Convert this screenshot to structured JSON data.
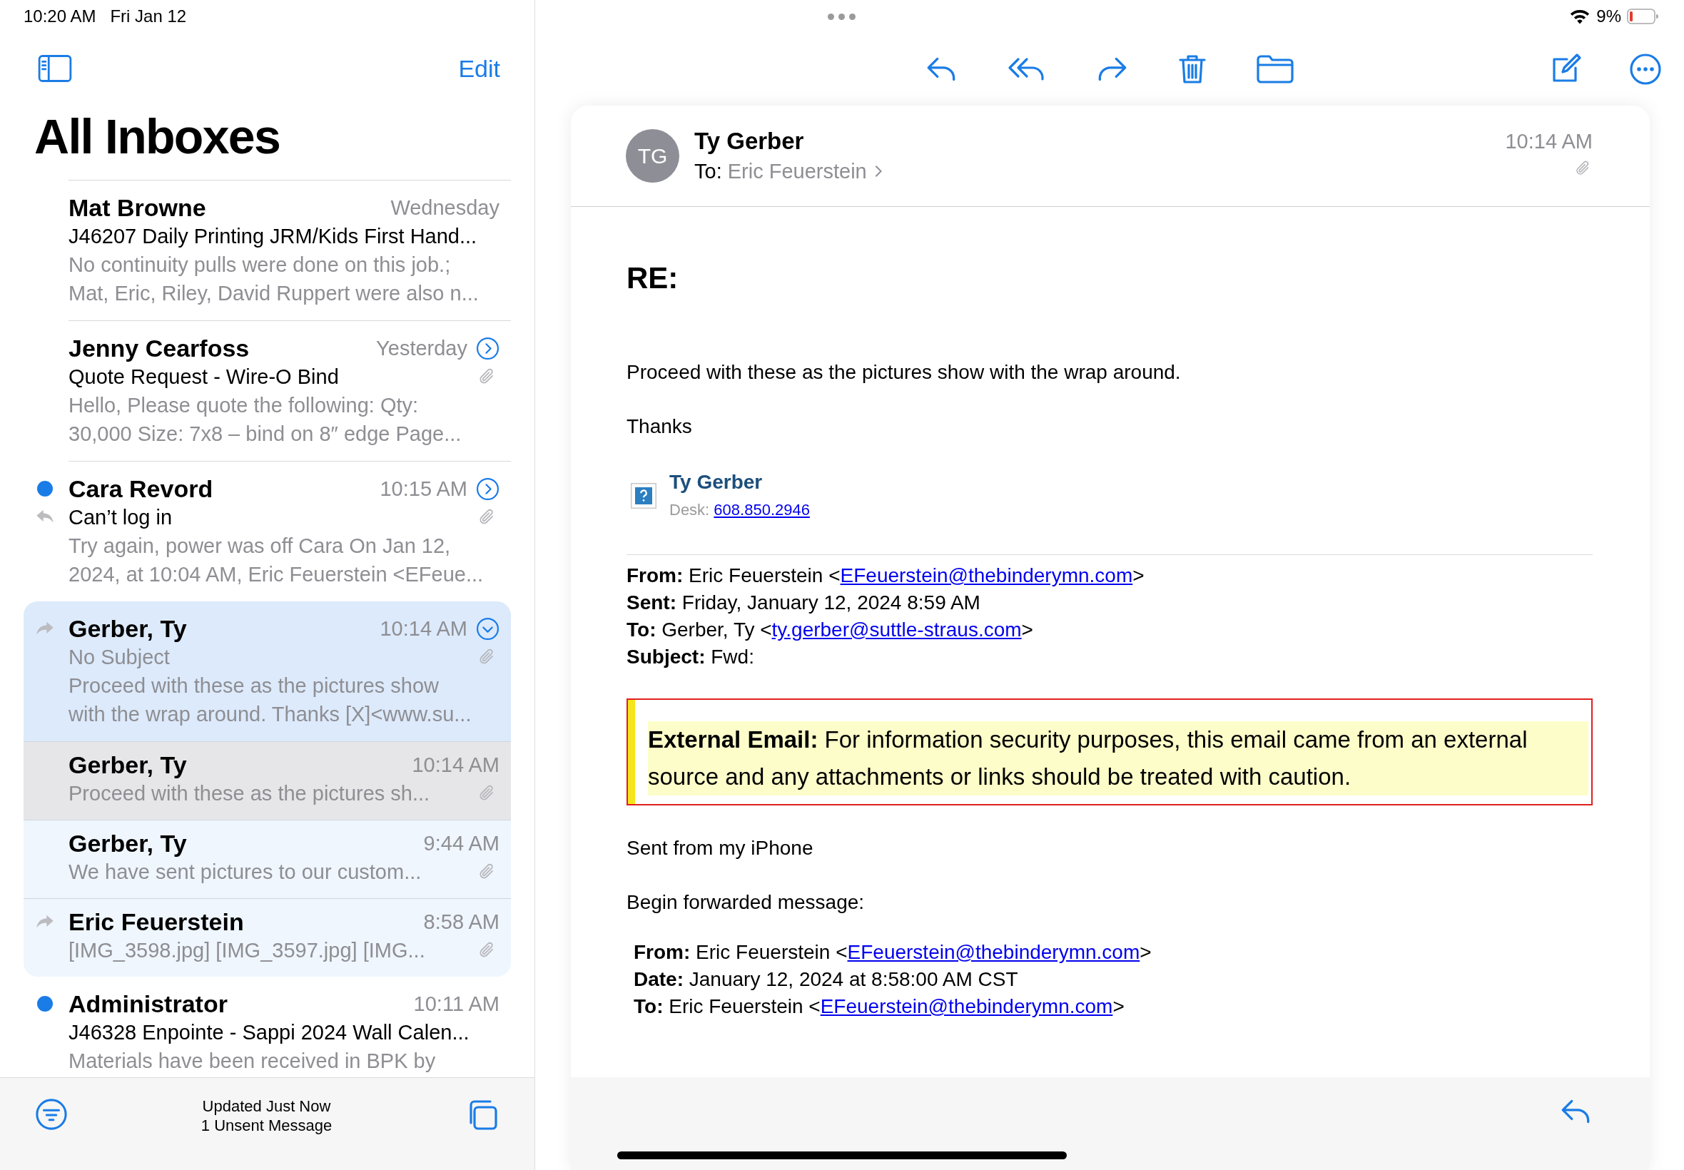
{
  "status_bar": {
    "time": "10:20 AM",
    "date": "Fri Jan 12",
    "battery": "9%"
  },
  "sidebar": {
    "edit": "Edit",
    "title": "All Inboxes",
    "messages": [
      {
        "sender": "Mat Browne",
        "time": "Wednesday",
        "subject": "J46207 Daily Printing JRM/Kids First Hand...",
        "preview": [
          "No continuity pulls were done on this job.;",
          "Mat, Eric, Riley, David Ruppert were also n..."
        ],
        "unread": false,
        "selected": false
      },
      {
        "sender": "Jenny Cearfoss",
        "time": "Yesterday",
        "subject": "Quote Request - Wire-O Bind",
        "preview": [
          "Hello, Please quote the following: Qty:",
          "30,000 Size: 7x8 – bind on 8″ edge Page..."
        ],
        "unread": false,
        "thread": true,
        "expanded": false,
        "attachment": true,
        "selected": false
      },
      {
        "sender": "Cara Revord",
        "time": "10:15 AM",
        "subject": "Can’t log in",
        "preview": [
          "Try again, power was off Cara On Jan 12,",
          "2024, at 10:04 AM, Eric Feuerstein <EFeue..."
        ],
        "unread": true,
        "replied": true,
        "thread": true,
        "expanded": false,
        "attachment": true,
        "selected": false
      },
      {
        "sender": "Gerber, Ty",
        "time": "10:14 AM",
        "subject_placeholder": "No Subject",
        "preview": [
          "Proceed with these as the pictures show",
          "with the wrap around. Thanks [X]<www.su..."
        ],
        "unread": false,
        "forwarded": true,
        "thread": true,
        "expanded": true,
        "attachment": true,
        "selected": true,
        "children": [
          {
            "sender": "Gerber, Ty",
            "time": "10:14 AM",
            "preview": [
              "Proceed with these as the pictures sh..."
            ],
            "attachment": true,
            "selected": true
          },
          {
            "sender": "Gerber, Ty",
            "time": "9:44 AM",
            "preview": [
              "We have sent pictures to our custom..."
            ],
            "attachment": true,
            "selected": false
          },
          {
            "sender": "Eric Feuerstein",
            "time": "8:58 AM",
            "preview": [
              "[IMG_3598.jpg] [IMG_3597.jpg] [IMG..."
            ],
            "forwarded": true,
            "attachment": true,
            "selected": false
          }
        ]
      },
      {
        "sender": "Administrator",
        "time": "10:11 AM",
        "subject": "J46328 Enpointe - Sappi 2024 Wall Calen...",
        "preview": [
          "Materials have been received in BPK by"
        ],
        "unread": true,
        "selected": false
      }
    ],
    "footer": [
      "Updated Just Now",
      "1 Unsent Message"
    ]
  },
  "message": {
    "initials": "TG",
    "sender": "Ty Gerber",
    "to_label": "To:",
    "to": "Eric Feuerstein",
    "time": "10:14 AM",
    "attachment": true,
    "subject": "RE:",
    "paragraphs": [
      "Proceed with these as the pictures show with the wrap around.",
      "Thanks"
    ],
    "signature": {
      "name": "Ty Gerber",
      "desk_label": "Desk:",
      "phone": "608.850.2946"
    },
    "headers": [
      {
        "label": "From:",
        "text": "Eric Feuerstein <",
        "link": "EFeuerstein@thebinderymn.com",
        "after": ">"
      },
      {
        "label": "Sent:",
        "text": "Friday, January 12, 2024 8:59 AM"
      },
      {
        "label": "To:",
        "text": "Gerber, Ty <",
        "link": "ty.gerber@suttle-straus.com",
        "after": ">"
      },
      {
        "label": "Subject:",
        "text": "Fwd:"
      }
    ],
    "warning": {
      "label": "External Email:",
      "text": "For information security purposes, this email came from an external source and any attachments or links should be treated with caution."
    },
    "closing": [
      "Sent from my iPhone",
      "Begin forwarded message:"
    ],
    "forwarded_headers": [
      {
        "label": "From:",
        "text": "Eric Feuerstein <",
        "link": "EFeuerstein@thebinderymn.com",
        "after": ">"
      },
      {
        "label": "Date:",
        "text": "January 12, 2024 at 8:58:00 AM CST"
      },
      {
        "label": "To:",
        "text": "Eric Feuerstein <",
        "link": "EFeuerstein@thebinderymn.com",
        "after": ">"
      }
    ]
  }
}
